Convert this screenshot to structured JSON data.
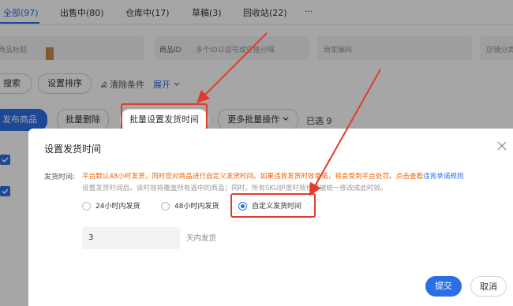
{
  "tabs": [
    {
      "label": "全部(97)"
    },
    {
      "label": "出售中(80)"
    },
    {
      "label": "仓库中(17)"
    },
    {
      "label": "草稿(3)"
    },
    {
      "label": "回收站(22)"
    },
    {
      "label": "···"
    }
  ],
  "filters": {
    "title_placeholder": "商品标题",
    "id_label": "商品ID",
    "id_placeholder": "多个ID以逗号或空格分隔",
    "code_placeholder": "商家编码",
    "category_placeholder": "店铺分类"
  },
  "toolbar": {
    "search": "搜索",
    "sort": "设置排序",
    "clear": "清除条件",
    "expand": "展开"
  },
  "actions": {
    "publish": "发布商品",
    "batch_delete": "批量删除",
    "batch_ship": "批量设置发货时间",
    "more": "更多批量操作",
    "selected": "已选 9"
  },
  "modal": {
    "title": "设置发货时间",
    "field_label": "发货时间:",
    "notice": "平台默认48小时发货，同时您对商品进行自定义发货时间。如果违背发货时效承诺，将会受到平台处罚。点击查看",
    "notice_link": "违背承诺规则",
    "hint": "设置发货时间后，该时效将覆盖所有选中的商品；同时，所有SKU护度时效也将被统一修改成此时效。",
    "options": [
      "24小时内发货",
      "48小时内发货",
      "自定义发货时间"
    ],
    "selected_option": "自定义发货时间",
    "days_value": "3",
    "days_suffix": "天内发货",
    "submit": "提交",
    "cancel": "取消"
  },
  "colors": {
    "accent": "#2b6fe6",
    "warning": "#e8620a",
    "annotation": "#e23b2e"
  }
}
